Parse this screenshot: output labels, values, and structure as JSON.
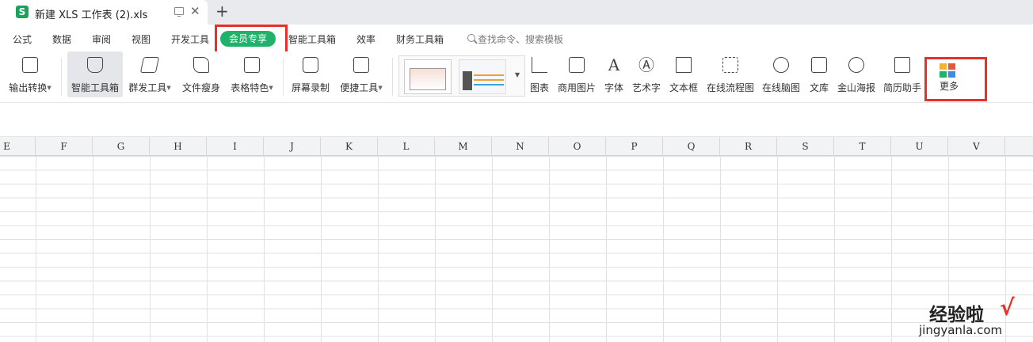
{
  "tab": {
    "app_icon": "S",
    "title": "新建 XLS 工作表 (2).xls",
    "new_tab": "+",
    "close": "✕"
  },
  "menu": {
    "items": [
      "公式",
      "数据",
      "审阅",
      "视图",
      "开发工具",
      "智能工具箱",
      "效率",
      "财务工具箱"
    ],
    "vip": "会员专享",
    "search": "查找命令、搜索模板"
  },
  "toolbar": {
    "tools": [
      "输出转换",
      "智能工具箱",
      "群发工具",
      "文件瘦身",
      "表格特色",
      "屏幕录制",
      "便捷工具"
    ],
    "insert": [
      "图表",
      "商用图片",
      "字体",
      "艺术字",
      "文本框",
      "在线流程图",
      "在线脑图",
      "文库",
      "金山海报",
      "简历助手"
    ],
    "more": "更多"
  },
  "sheet": {
    "columns": [
      "E",
      "F",
      "G",
      "H",
      "I",
      "J",
      "K",
      "L",
      "M",
      "N",
      "O",
      "P",
      "Q",
      "R",
      "S",
      "T",
      "U",
      "V"
    ]
  },
  "watermark": {
    "text": "经验啦",
    "check": "√",
    "url": "jingyanla.com"
  },
  "colors": {
    "vip_green": "#20b26b",
    "highlight_red": "#e8302a",
    "app_green": "#1aa35c"
  }
}
